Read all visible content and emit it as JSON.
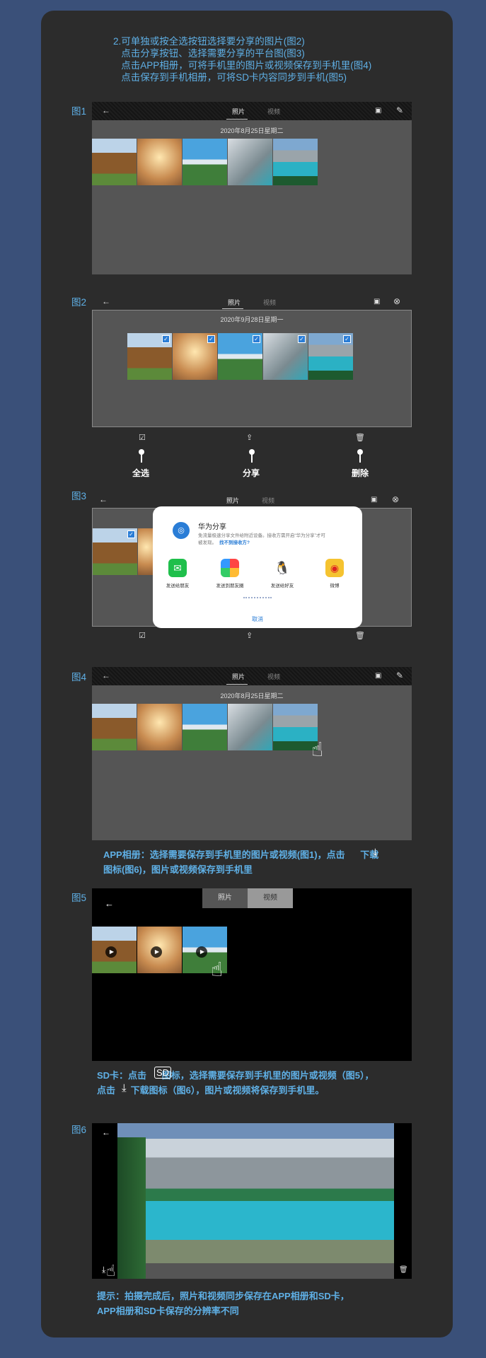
{
  "intro": {
    "lines": "2.可单独或按全选按钮选择要分享的图片(图2)\n   点击分享按钮、选择需要分享的平台图(图3)\n   点击APP相册，可将手机里的图片或视频保存到手机里(图4)\n   点击保存到手机相册，可将SD卡内容同步到手机(图5)"
  },
  "figures": {
    "f1": {
      "label": "图1",
      "tab_photos": "照片",
      "tab_videos": "视频",
      "date": "2020年8月25日星期二"
    },
    "f2": {
      "label": "图2",
      "tab_photos": "照片",
      "tab_videos": "视频",
      "date": "2020年9月28日星期一"
    },
    "f3": {
      "label": "图3",
      "tab_photos": "照片",
      "tab_videos": "视频"
    },
    "f4": {
      "label": "图4",
      "tab_photos": "照片",
      "tab_videos": "视频",
      "date": "2020年8月25日星期二"
    },
    "f5": {
      "label": "图5",
      "tab_photos": "照片",
      "tab_videos": "视频"
    },
    "f6": {
      "label": "图6"
    }
  },
  "actions": {
    "select_all": "全选",
    "share": "分享",
    "delete": "删除"
  },
  "share_dialog": {
    "title": "华为分享",
    "desc_line1": "免流量极速分享文件给附近设备。接收方需开启“华为分享”才可",
    "desc_line2": "被发现。",
    "link": "找不到接收方?",
    "apps": [
      {
        "label": "发送给朋友",
        "icon": "wechat-icon",
        "color": "#1fbf4b"
      },
      {
        "label": "发送到朋友圈",
        "icon": "moments-icon",
        "color": "#f2a23a"
      },
      {
        "label": "发送给好友",
        "icon": "qq-icon",
        "color": "#222222"
      },
      {
        "label": "微博",
        "icon": "weibo-icon",
        "color": "#f5c330"
      }
    ],
    "cancel": "取消"
  },
  "notes": {
    "app_album": "APP相册：选择需要保存到手机里的图片或视频(图1)，点击      下载\n图标(图6)，图片或视频保存到手机里",
    "sd_card": "SD卡：点击      图标，选择需要保存到手机里的图片或视频（图5），\n点击      下载图标（图6），图片或视频将保存到手机里。",
    "tip": "提示：拍摄完成后，照片和视频同步保存在APP相册和SD卡，\nAPP相册和SD卡保存的分辨率不同"
  },
  "colors": {
    "accent": "#5fb0e6",
    "page_bg": "#3a5079",
    "card_bg": "#2c2c2c",
    "check": "#2a7dd6",
    "link": "#2a7dd6"
  }
}
